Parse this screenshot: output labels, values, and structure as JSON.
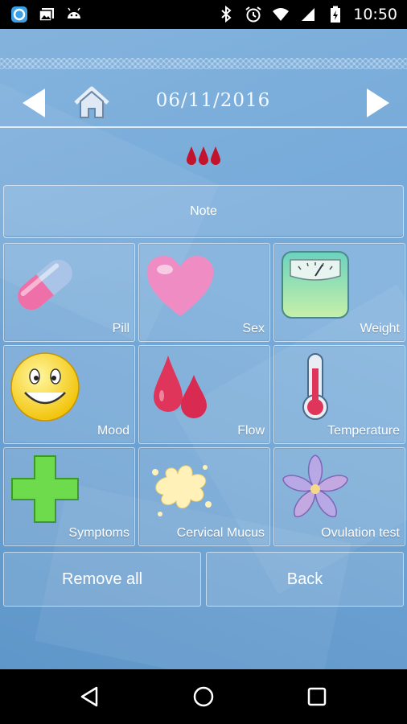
{
  "status_bar": {
    "time": "10:50",
    "left_icons": [
      "app-icon",
      "photo-icon",
      "android-icon"
    ],
    "right_icons": [
      "bluetooth-icon",
      "alarm-icon",
      "wifi-icon",
      "cell-signal-icon",
      "battery-icon"
    ]
  },
  "header": {
    "date": "06/11/2016",
    "prev_icon": "left-arrow-icon",
    "next_icon": "right-arrow-icon",
    "home_icon": "home-icon",
    "flow_icon": "blood-drops-icon"
  },
  "note": {
    "label": "Note"
  },
  "grid": {
    "items": [
      {
        "label": "Pill",
        "icon": "pill-icon"
      },
      {
        "label": "Sex",
        "icon": "heart-icon"
      },
      {
        "label": "Weight",
        "icon": "scale-icon"
      },
      {
        "label": "Mood",
        "icon": "smiley-icon"
      },
      {
        "label": "Flow",
        "icon": "drops-icon"
      },
      {
        "label": "Temperature",
        "icon": "thermometer-icon"
      },
      {
        "label": "Symptoms",
        "icon": "plus-icon"
      },
      {
        "label": "Cervical Mucus",
        "icon": "splash-icon"
      },
      {
        "label": "Ovulation test",
        "icon": "flower-icon"
      }
    ]
  },
  "buttons": {
    "remove_all": "Remove all",
    "back": "Back"
  },
  "colors": {
    "background": "#6aa3d6",
    "accent_red": "#c2142c",
    "text": "#ffffff"
  }
}
